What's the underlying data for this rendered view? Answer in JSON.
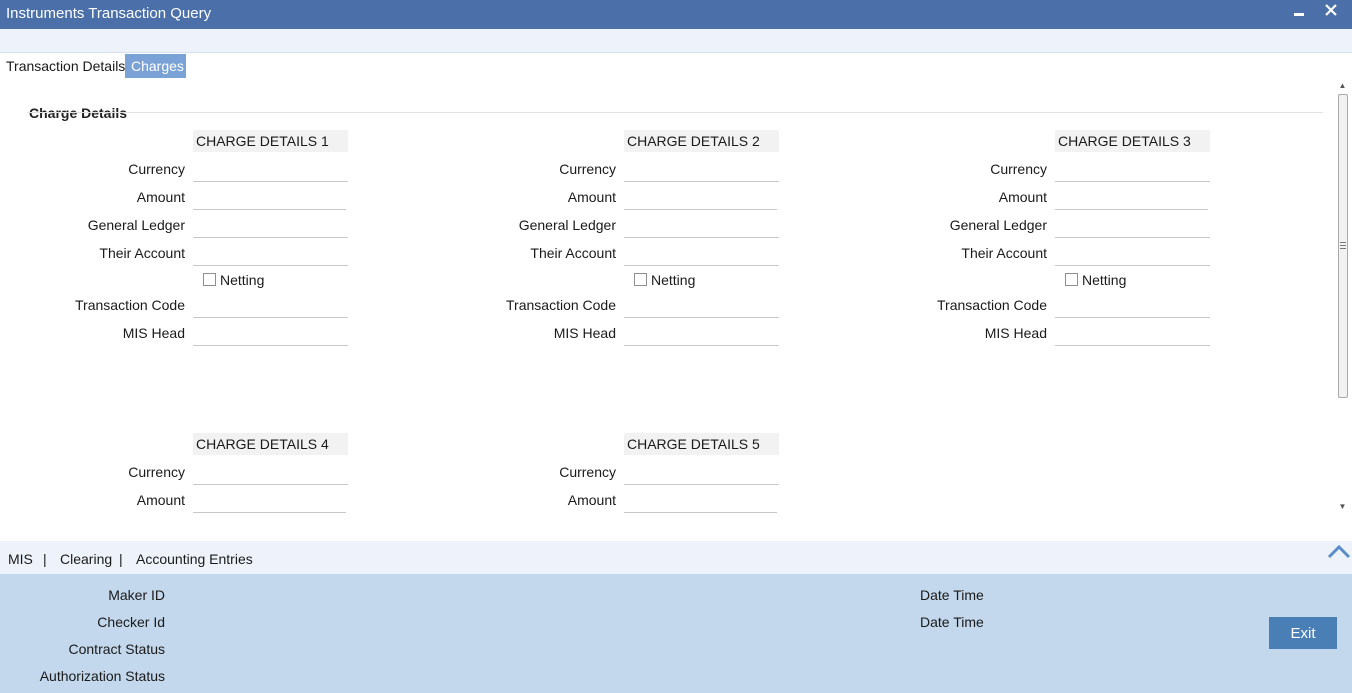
{
  "window": {
    "title": "Instruments Transaction Query",
    "minimize_glyph": "▁",
    "close_glyph": "✕"
  },
  "tabs": [
    {
      "label": "Transaction Details",
      "active": true
    },
    {
      "label": "Charges",
      "active": false
    }
  ],
  "section": {
    "header": "Charge Details"
  },
  "labels": {
    "currency": "Currency",
    "amount": "Amount",
    "general_ledger": "General Ledger",
    "their_account": "Their Account",
    "netting": "Netting",
    "transaction_code": "Transaction Code",
    "mis_head": "MIS Head"
  },
  "charge_blocks": [
    {
      "title": "CHARGE DETAILS 1",
      "currency": "",
      "amount": "",
      "general_ledger": "",
      "their_account": "",
      "netting": false,
      "transaction_code": "",
      "mis_head": ""
    },
    {
      "title": "CHARGE DETAILS 2",
      "currency": "",
      "amount": "",
      "general_ledger": "",
      "their_account": "",
      "netting": false,
      "transaction_code": "",
      "mis_head": ""
    },
    {
      "title": "CHARGE DETAILS 3",
      "currency": "",
      "amount": "",
      "general_ledger": "",
      "their_account": "",
      "netting": false,
      "transaction_code": "",
      "mis_head": ""
    },
    {
      "title": "CHARGE DETAILS 4",
      "currency": "",
      "amount": ""
    },
    {
      "title": "CHARGE DETAILS 5",
      "currency": "",
      "amount": ""
    }
  ],
  "links": {
    "items": [
      "MIS",
      "Clearing",
      "Accounting Entries"
    ],
    "separator": "|"
  },
  "footer": {
    "maker_id": "Maker ID",
    "checker_id": "Checker Id",
    "contract_status": "Contract Status",
    "authorization_status": "Authorization Status",
    "date_time_1": "Date Time",
    "date_time_2": "Date Time",
    "exit_label": "Exit"
  },
  "colors": {
    "titlebar": "#4a6fa9",
    "active_tab_inactive_bg": "#7aa2d6",
    "footer_bg": "#c3d8ec",
    "exit_button": "#4a7fb6"
  }
}
